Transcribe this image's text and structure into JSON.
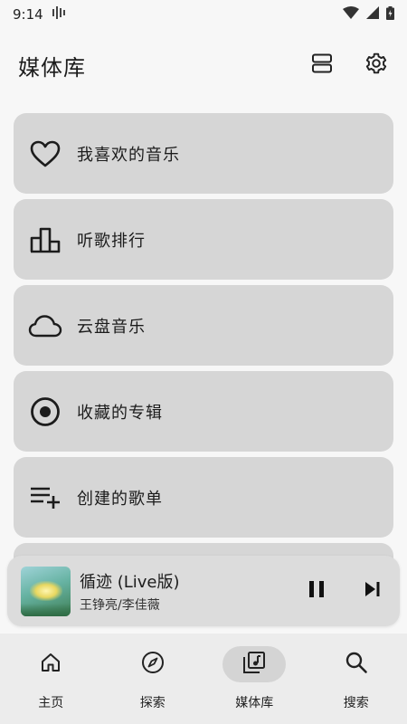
{
  "status_bar": {
    "time": "9:14"
  },
  "header": {
    "title": "媒体库",
    "actions": [
      {
        "icon": "layout-icon"
      },
      {
        "icon": "gear-icon"
      }
    ]
  },
  "library_items": [
    {
      "label": "我喜欢的音乐",
      "icon": "heart-icon"
    },
    {
      "label": "听歌排行",
      "icon": "bar-chart-icon"
    },
    {
      "label": "云盘音乐",
      "icon": "cloud-icon"
    },
    {
      "label": "收藏的专辑",
      "icon": "album-icon"
    },
    {
      "label": "创建的歌单",
      "icon": "playlist-add-icon"
    }
  ],
  "now_playing": {
    "title": "循迹 (Live版)",
    "artist": "王铮亮/李佳薇",
    "state": "playing"
  },
  "bottom_nav": {
    "items": [
      {
        "label": "主页",
        "icon": "home-icon",
        "active": false
      },
      {
        "label": "探索",
        "icon": "compass-icon",
        "active": false
      },
      {
        "label": "媒体库",
        "icon": "library-music-icon",
        "active": true
      },
      {
        "label": "搜索",
        "icon": "search-icon",
        "active": false
      }
    ]
  },
  "colors": {
    "background": "#f7f7f7",
    "card": "#d6d6d6",
    "player": "#dcdcdc",
    "nav": "#ececec",
    "active_pill": "#d4d4d4",
    "text": "#1c1c1c"
  }
}
